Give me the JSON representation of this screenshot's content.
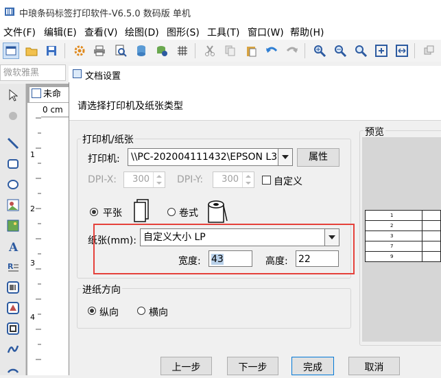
{
  "app": {
    "title": "中琅条码标签打印软件-V6.5.0 数码版 单机"
  },
  "menu": [
    "文件(F)",
    "编辑(E)",
    "查看(V)",
    "绘图(D)",
    "图形(S)",
    "工具(T)",
    "窗口(W)",
    "帮助(H)"
  ],
  "font": {
    "name": "微软雅黑"
  },
  "document": {
    "tab": "未命名",
    "ruler_label": "0 cm",
    "ruler_marks": [
      "1",
      "2",
      "3",
      "4"
    ]
  },
  "dialog": {
    "title": "文档设置",
    "heading": "请选择打印机及纸张类型",
    "printer_group": "打印机/纸张",
    "printer_label": "打印机:",
    "printer_value": "\\\\PC-202004111432\\EPSON L3...",
    "properties_button": "属性",
    "dpi_x_label": "DPI-X:",
    "dpi_x_value": "300",
    "dpi_y_label": "DPI-Y:",
    "dpi_y_value": "300",
    "custom_label": "自定义",
    "flat_label": "平张",
    "roll_label": "卷式",
    "paper_label": "纸张(mm):",
    "paper_value": "自定义大小 LP",
    "width_label": "宽度:",
    "width_value": "43",
    "height_label": "高度:",
    "height_value": "22",
    "feed_group": "进纸方向",
    "portrait_label": "纵向",
    "landscape_label": "横向",
    "preview_label": "预览",
    "preview_rows": [
      "1",
      "2",
      "3",
      "7",
      "9"
    ],
    "buttons": {
      "prev": "上一步",
      "next": "下一步",
      "finish": "完成",
      "cancel": "取消"
    }
  },
  "colors": {
    "highlight_box": "#e5403a",
    "selection": "#cfe2f7"
  }
}
